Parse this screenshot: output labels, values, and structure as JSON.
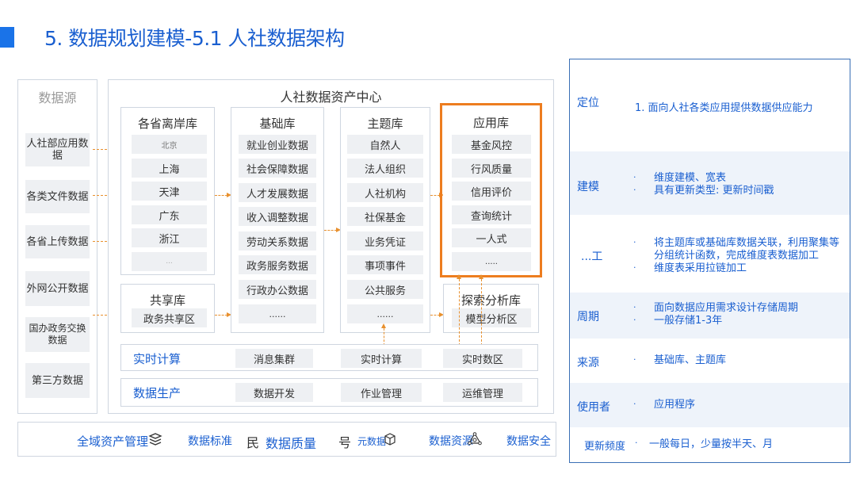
{
  "header": {
    "title": "5. 数据规划建模-5.1 人社数据架构"
  },
  "sources": {
    "title": "数据源",
    "items": [
      "人社部应用数据",
      "各类文件数据",
      "各省上传数据",
      "外网公开数据",
      "国办政务交换数据",
      "第三方数据"
    ]
  },
  "center": {
    "title": "人社数据资产中心"
  },
  "provincial": {
    "title": "各省离岸库",
    "items": [
      "北京",
      "上海",
      "天津",
      "广东",
      "浙江",
      "..."
    ]
  },
  "shared": {
    "title": "共享库",
    "items": [
      "政务共享区"
    ]
  },
  "base": {
    "title": "基础库",
    "items": [
      "就业创业数据",
      "社会保障数据",
      "人才发展数据",
      "收入调整数据",
      "劳动关系数据",
      "政务服务数据",
      "行政办公数据",
      "......"
    ]
  },
  "theme": {
    "title": "主题库",
    "items": [
      "自然人",
      "法人组织",
      "人社机构",
      "社保基金",
      "业务凭证",
      "事项事件",
      "公共服务",
      "......"
    ]
  },
  "app": {
    "title": "应用库",
    "items": [
      "基金风控",
      "行风质量",
      "信用评价",
      "查询统计",
      "一人式",
      "....."
    ]
  },
  "explore": {
    "title": "探索分析库",
    "items": [
      "模型分析区"
    ]
  },
  "realtime": {
    "label": "实时计算",
    "items": [
      "消息集群",
      "实时计算",
      "实时数区"
    ]
  },
  "production": {
    "label": "数据生产",
    "items": [
      "数据开发",
      "作业管理",
      "运维管理"
    ]
  },
  "bottom": {
    "items": [
      "全域资产管理",
      "数据标准",
      "数据质量",
      "元数据",
      "数据资源",
      "数据安全"
    ],
    "icons": [
      "layers-icon",
      "standard-icon",
      "quality-icon",
      "cube-icon",
      "network-icon"
    ]
  },
  "spec": {
    "rows": [
      {
        "label": "定位",
        "lines": [
          "1. 面向人社各类应用提供数据供应能力"
        ]
      },
      {
        "label": "建模",
        "lines": [
          "维度建模、宽表",
          "具有更新类型: 更新时间戳"
        ]
      },
      {
        "label": "...工",
        "lines": [
          "将主题库或基础库数据关联，利用聚集等",
          "分组统计函数，完成维度表数据加工",
          "维度表采用拉链加工"
        ]
      },
      {
        "label": "周期",
        "lines": [
          "面向数据应用需求设计存储周期",
          "一般存储1-3年"
        ]
      },
      {
        "label": "来源",
        "lines": [
          "基础库、主题库"
        ]
      },
      {
        "label": "使用者",
        "lines": [
          "应用程序"
        ]
      },
      {
        "label": "更新频度",
        "lines": [
          "一般每日，少量按半天、月"
        ]
      }
    ]
  },
  "colors": {
    "accent": "#1a73e8",
    "highlight": "#ed7d1f",
    "text_blue": "#1a5fd0",
    "cell_bg": "#eef0f3"
  }
}
